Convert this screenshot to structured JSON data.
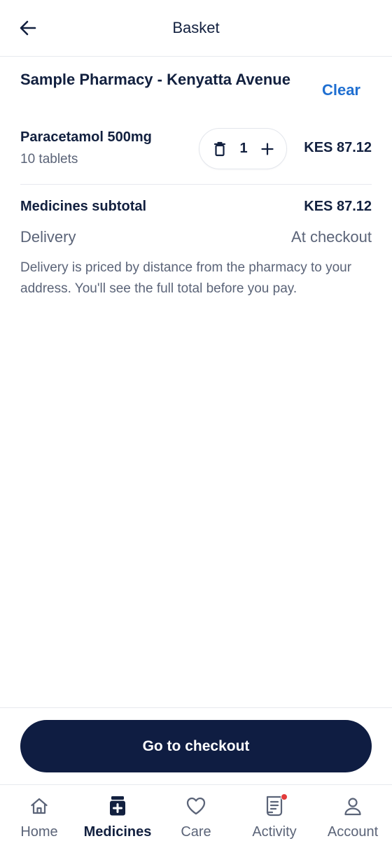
{
  "header": {
    "title": "Basket",
    "back_icon": "arrow-left-icon"
  },
  "pharmacy": {
    "name": "Sample Pharmacy - Kenyatta Avenue",
    "clear_label": "Clear"
  },
  "items": [
    {
      "name": "Paracetamol 500mg",
      "description": "10 tablets",
      "quantity": "1",
      "price": "KES 87.12"
    }
  ],
  "summary": {
    "subtotal_label": "Medicines subtotal",
    "subtotal_value": "KES 87.12",
    "delivery_label": "Delivery",
    "delivery_value": "At checkout",
    "delivery_note": "Delivery is priced by distance from the pharmacy to your address. You'll see the full total before you pay."
  },
  "checkout": {
    "button_label": "Go to checkout"
  },
  "nav": {
    "items": [
      {
        "label": "Home",
        "icon": "home-icon",
        "active": false
      },
      {
        "label": "Medicines",
        "icon": "medicine-icon",
        "active": true
      },
      {
        "label": "Care",
        "icon": "heart-icon",
        "active": false
      },
      {
        "label": "Activity",
        "icon": "receipt-icon",
        "active": false,
        "badge": true
      },
      {
        "label": "Account",
        "icon": "user-icon",
        "active": false
      }
    ]
  },
  "colors": {
    "primary_dark": "#0f1d42",
    "link_blue": "#1f6fd1",
    "text_primary": "#12203f",
    "text_secondary": "#5b6478",
    "badge_red": "#e23b3b"
  }
}
